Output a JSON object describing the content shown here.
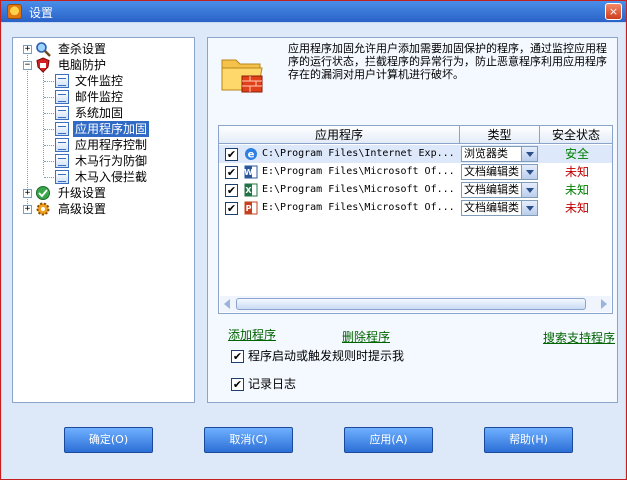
{
  "window": {
    "title": "设置",
    "close_label": "×"
  },
  "tree": {
    "items": [
      {
        "label": "查杀设置",
        "expander": "+"
      },
      {
        "label": "电脑防护",
        "expander": "−"
      },
      {
        "label": "文件监控"
      },
      {
        "label": "邮件监控"
      },
      {
        "label": "系统加固"
      },
      {
        "label": "应用程序加固"
      },
      {
        "label": "应用程序控制"
      },
      {
        "label": "木马行为防御"
      },
      {
        "label": "木马入侵拦截"
      },
      {
        "label": "升级设置",
        "expander": "+"
      },
      {
        "label": "高级设置",
        "expander": "+"
      }
    ],
    "selected": "应用程序加固"
  },
  "description": "应用程序加固允许用户添加需要加固保护的程序，通过监控应用程序的运行状态，拦截程序的异常行为，防止恶意程序利用应用程序存在的漏洞对用户计算机进行破坏。",
  "table": {
    "headers": [
      "应用程序",
      "类型",
      "安全状态"
    ],
    "rows": [
      {
        "checked": "✔",
        "icon": "ie-icon",
        "path": "C:\\Program Files\\Internet Exp...",
        "type": "浏览器类",
        "status": "安全",
        "status_color": "#008000"
      },
      {
        "checked": "✔",
        "icon": "word-icon",
        "path": "E:\\Program Files\\Microsoft Of...",
        "type": "文档编辑类",
        "status": "未知",
        "status_color": "#c00000"
      },
      {
        "checked": "✔",
        "icon": "excel-icon",
        "path": "E:\\Program Files\\Microsoft Of...",
        "type": "文档编辑类",
        "status": "未知",
        "status_color": "#008000"
      },
      {
        "checked": "✔",
        "icon": "powerpoint-icon",
        "path": "E:\\Program Files\\Microsoft Of...",
        "type": "文档编辑类",
        "status": "未知",
        "status_color": "#c00000"
      }
    ]
  },
  "links": {
    "add": "添加程序",
    "delete": "删除程序",
    "search": "搜索支持程序"
  },
  "options": {
    "prompt": {
      "checked": "✔",
      "label": "程序启动或触发规则时提示我"
    },
    "log": {
      "checked": "✔",
      "label": "记录日志"
    }
  },
  "buttons": {
    "ok": "确定(O)",
    "cancel": "取消(C)",
    "apply": "应用(A)",
    "help": "帮助(H)"
  },
  "colors": {
    "link": "#006400",
    "selection": "#316ac5",
    "button": "#2c6fd6"
  }
}
